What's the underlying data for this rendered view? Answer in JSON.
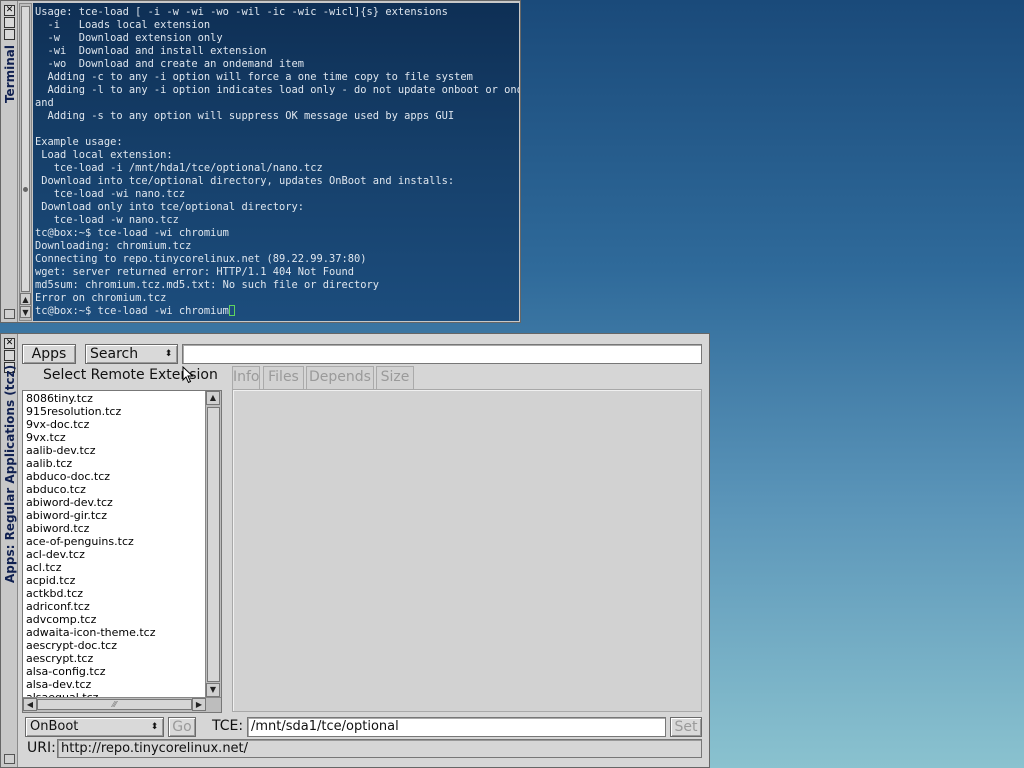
{
  "terminal": {
    "title": "Terminal",
    "lines": [
      "Usage: tce-load [ -i -w -wi -wo -wil -ic -wic -wicl]{s} extensions",
      "  -i   Loads local extension",
      "  -w   Download extension only",
      "  -wi  Download and install extension",
      "  -wo  Download and create an ondemand item",
      "  Adding -c to any -i option will force a one time copy to file system",
      "  Adding -l to any -i option indicates load only - do not update onboot or ondem",
      "and",
      "  Adding -s to any option will suppress OK message used by apps GUI",
      "",
      "Example usage:",
      " Load local extension:",
      "   tce-load -i /mnt/hda1/tce/optional/nano.tcz",
      " Download into tce/optional directory, updates OnBoot and installs:",
      "   tce-load -wi nano.tcz",
      " Download only into tce/optional directory:",
      "   tce-load -w nano.tcz",
      "tc@box:~$ tce-load -wi chromium",
      "Downloading: chromium.tcz",
      "Connecting to repo.tinycorelinux.net (89.22.99.37:80)",
      "wget: server returned error: HTTP/1.1 404 Not Found",
      "md5sum: chromium.tcz.md5.txt: No such file or directory",
      "Error on chromium.tcz"
    ],
    "prompt_line": "tc@box:~$ tce-load -wi chromium"
  },
  "apps": {
    "title": "Apps: Regular Applications (tcz)",
    "apps_button": "Apps",
    "search_select": "Search",
    "search_value": "",
    "list_heading": "Select Remote Extension",
    "tabs": [
      "Info",
      "Files",
      "Depends",
      "Size"
    ],
    "extensions": [
      "8086tiny.tcz",
      "915resolution.tcz",
      "9vx-doc.tcz",
      "9vx.tcz",
      "aalib-dev.tcz",
      "aalib.tcz",
      "abduco-doc.tcz",
      "abduco.tcz",
      "abiword-dev.tcz",
      "abiword-gir.tcz",
      "abiword.tcz",
      "ace-of-penguins.tcz",
      "acl-dev.tcz",
      "acl.tcz",
      "acpid.tcz",
      "actkbd.tcz",
      "adriconf.tcz",
      "advcomp.tcz",
      "adwaita-icon-theme.tcz",
      "aescrypt-doc.tcz",
      "aescrypt.tcz",
      "alsa-config.tcz",
      "alsa-dev.tcz",
      "alsaequal.tcz"
    ],
    "install_mode": "OnBoot",
    "go_button": "Go",
    "tce_label": "TCE:",
    "tce_path": "/mnt/sda1/tce/optional",
    "set_button": "Set",
    "uri_label": "URI:",
    "uri_value": "http://repo.tinycorelinux.net/"
  }
}
